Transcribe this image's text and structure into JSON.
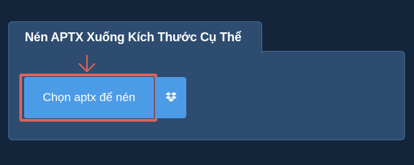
{
  "panel": {
    "title": "Nén APTX Xuống Kích Thước Cụ Thể"
  },
  "upload": {
    "choose_label": "Chọn aptx để nén",
    "dropbox_icon": "dropbox-icon"
  },
  "colors": {
    "page_background": "#13253b",
    "panel_background": "#2d4c70",
    "button_blue": "#4c9be6",
    "highlight_red": "#d9635b"
  }
}
